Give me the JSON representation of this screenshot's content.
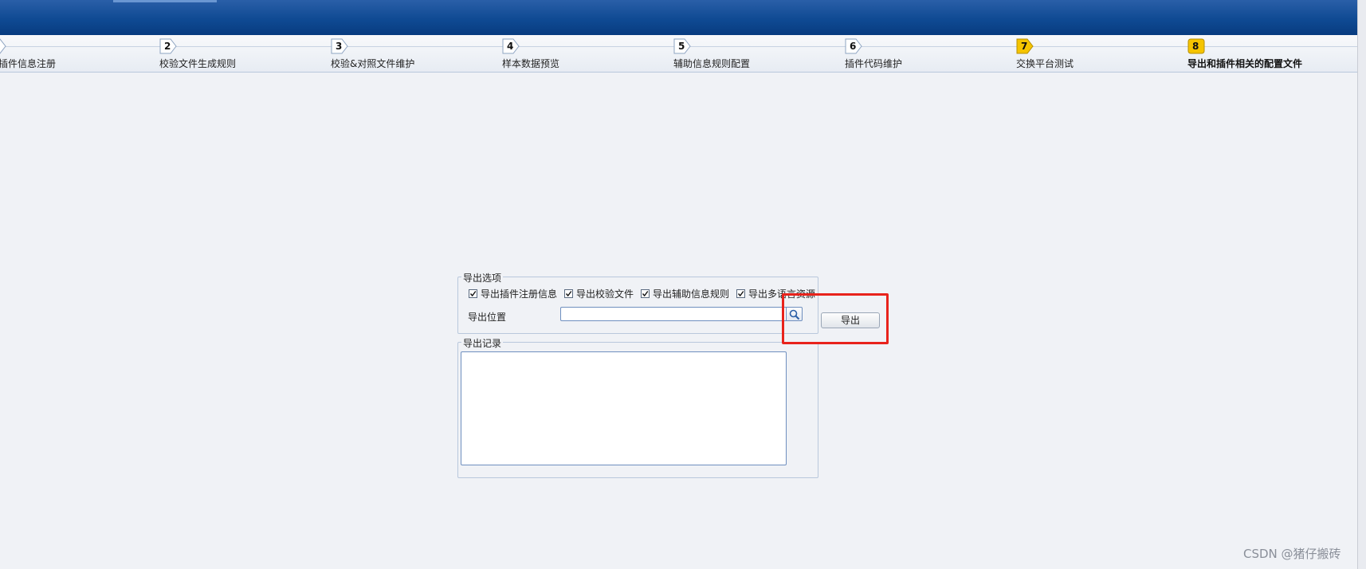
{
  "wizard": {
    "steps": [
      {
        "number": "",
        "label": "据插件信息注册",
        "state": "done"
      },
      {
        "number": "2",
        "label": "校验文件生成规则",
        "state": "done"
      },
      {
        "number": "3",
        "label": "校验&对照文件维护",
        "state": "done"
      },
      {
        "number": "4",
        "label": "样本数据预览",
        "state": "done"
      },
      {
        "number": "5",
        "label": "辅助信息规则配置",
        "state": "done"
      },
      {
        "number": "6",
        "label": "插件代码维护",
        "state": "done"
      },
      {
        "number": "7",
        "label": "交换平台测试",
        "state": "done-highlight"
      },
      {
        "number": "8",
        "label": "导出和插件相关的配置文件",
        "state": "active"
      }
    ]
  },
  "export_options": {
    "legend": "导出选项",
    "checkboxes": [
      {
        "label": "导出插件注册信息",
        "checked": true
      },
      {
        "label": "导出校验文件",
        "checked": true
      },
      {
        "label": "导出辅助信息规则",
        "checked": true
      },
      {
        "label": "导出多语言资源",
        "checked": true
      }
    ],
    "path_label": "导出位置",
    "path_value": "",
    "export_button": "导出"
  },
  "export_log": {
    "legend": "导出记录",
    "content": ""
  },
  "watermark": "CSDN @猪仔搬砖",
  "colors": {
    "banner": "#0f4a93",
    "step_badge_yellow": "#f5c400",
    "highlight_box": "#e8231c"
  }
}
